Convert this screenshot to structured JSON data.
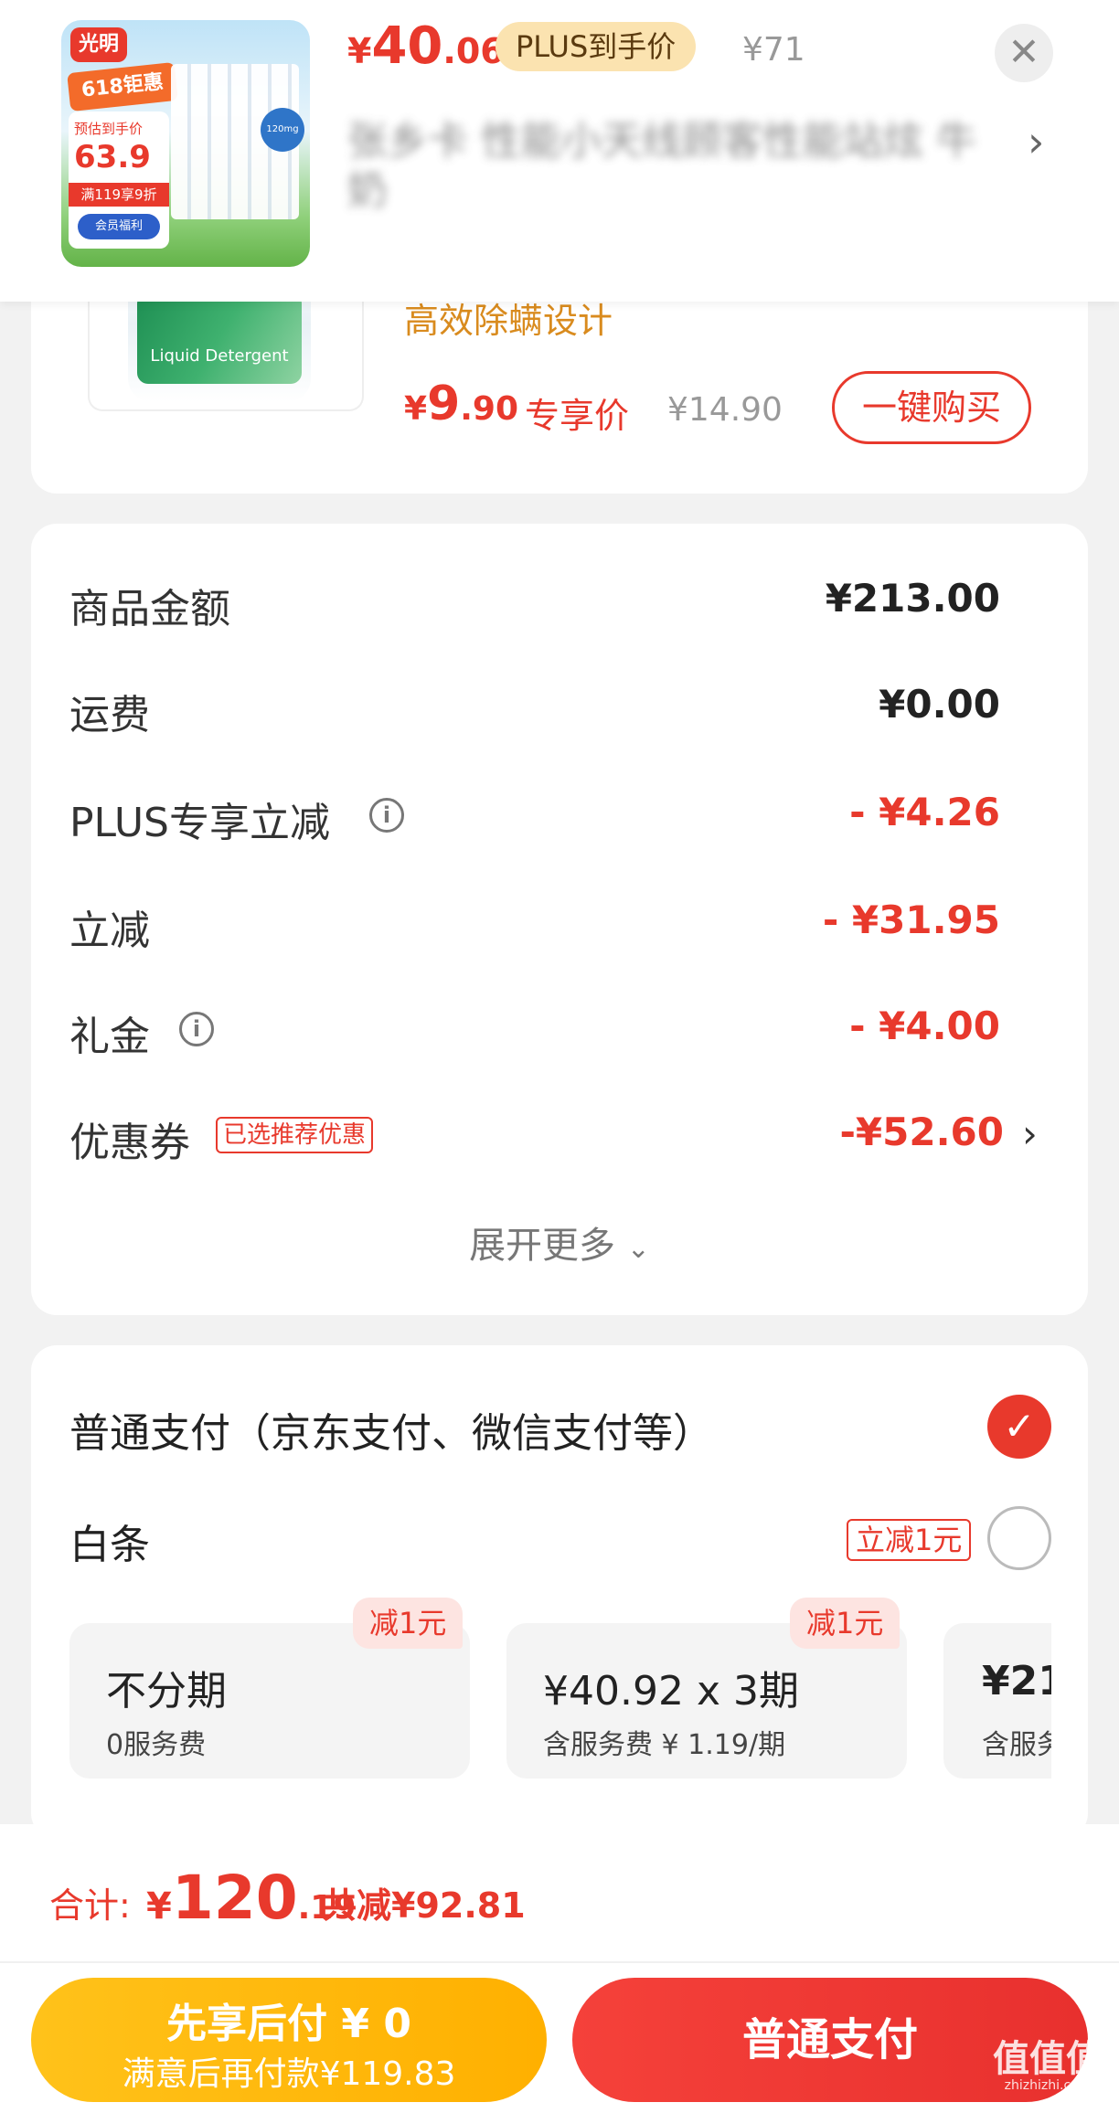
{
  "topbar": {
    "price_symbol": "¥",
    "price_int": "40",
    "price_dec": ".06",
    "plus_tag": "PLUS到手价",
    "original_price": "¥71",
    "title_blurred": "张乡卡 性能小天线顾客性能站炫 牛奶",
    "thumb": {
      "brand": "光明",
      "promo": "618钜惠",
      "pre_price_label": "预估到手价",
      "pre_price": "63.9",
      "promo_line": "满119享9折",
      "member_tag": "会员福利",
      "badge": "120mg"
    }
  },
  "product": {
    "feature": "高效除螨设计",
    "price_symbol": "¥",
    "price_int": "9",
    "price_dec": ".90",
    "exclusive_label": "专享价",
    "original_price": "¥14.90",
    "buy_button": "一键购买",
    "image_label": "Liquid Detergent"
  },
  "summary": {
    "rows": [
      {
        "label": "商品金额",
        "value": "¥213.00",
        "color": "#222222"
      },
      {
        "label": "运费",
        "value": "¥0.00",
        "color": "#222222"
      },
      {
        "label": "PLUS专享立减",
        "value": "- ¥4.26",
        "color": "#e8392c"
      },
      {
        "label": "立减",
        "value": "- ¥31.95",
        "color": "#e8392c"
      },
      {
        "label": "礼金",
        "value": "- ¥4.00",
        "color": "#e8392c"
      },
      {
        "label": "优惠券",
        "value": "-¥52.60",
        "color": "#e8392c"
      }
    ],
    "coupon_tag": "已选推荐优惠",
    "info_icon": "i",
    "expand_more": "展开更多"
  },
  "payment": {
    "normal_label": "普通支付（京东支付、微信支付等）",
    "baitiao_label": "白条",
    "baitiao_tag": "立减1元",
    "plans": [
      {
        "tag": "减1元",
        "title": "不分期",
        "sub": "0服务费"
      },
      {
        "tag": "减1元",
        "title": "¥40.92 x 3期",
        "sub": "含服务费 ¥ 1.19/期"
      },
      {
        "tag": "",
        "title": "¥21",
        "sub": "含服务"
      }
    ]
  },
  "footer": {
    "total_label": "合计:",
    "total_symbol": "¥",
    "total_int": "120",
    "total_dec": ".19",
    "total_save": "共减¥92.81",
    "later_line1": "先享后付 ¥ 0",
    "later_line2": "满意后再付款¥119.83",
    "normal_pay": "普通支付"
  },
  "watermark": {
    "main": "值值值",
    "sub": "zhizhizhi.com"
  },
  "colors": {
    "accent": "#e8392c",
    "gold": "#ffb000",
    "background": "#f2f2f2"
  }
}
